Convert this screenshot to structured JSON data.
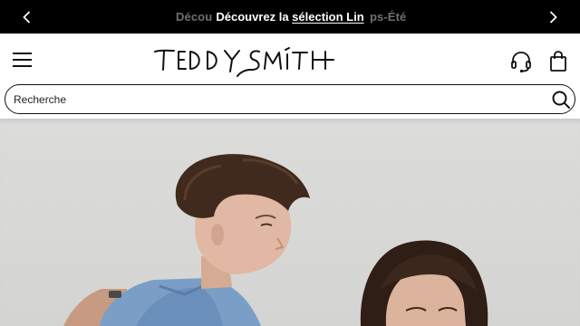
{
  "promo": {
    "message_prefix": "Découvrez la ",
    "message_link": "sélection Lin",
    "ghost_left": "Décou",
    "ghost_right": "ps-Été"
  },
  "header": {
    "logo_text": "TEDDY SMITH"
  },
  "search": {
    "placeholder": "Recherche"
  },
  "colors": {
    "promo_bg": "#000000",
    "promo_text": "#ffffff",
    "hero_bg": "#d6d6d4"
  },
  "icons": {
    "prev": "chevron-left-icon",
    "next": "chevron-right-icon",
    "menu": "hamburger-menu-icon",
    "support": "headset-icon",
    "bag": "shopping-bag-icon",
    "search": "search-icon"
  }
}
